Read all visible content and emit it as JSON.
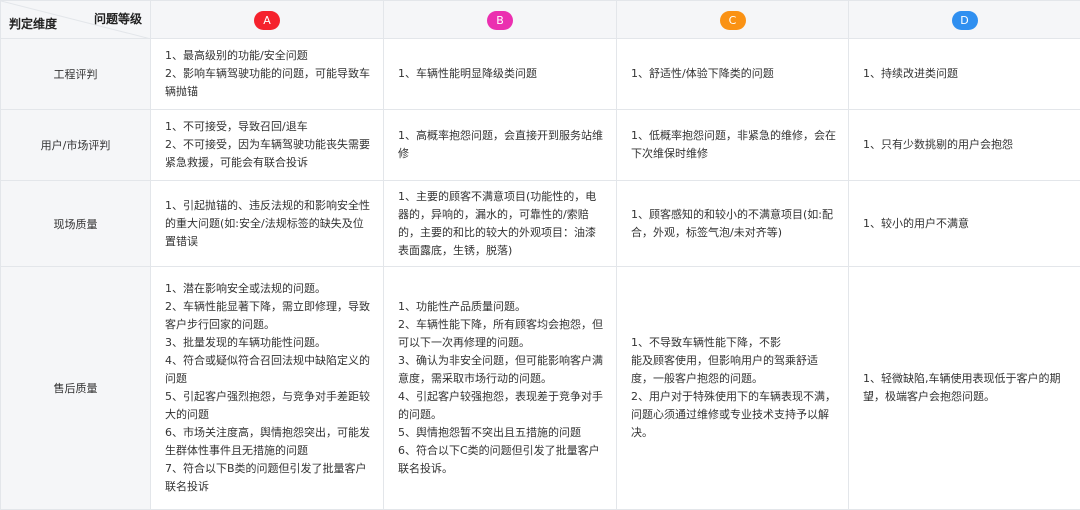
{
  "header": {
    "corner_top": "问题等级",
    "corner_bottom": "判定维度",
    "levels": [
      {
        "label": "A",
        "color": "#f5222d"
      },
      {
        "label": "B",
        "color": "#eb2fb0"
      },
      {
        "label": "C",
        "color": "#fa9214"
      },
      {
        "label": "D",
        "color": "#2f8ff0"
      }
    ]
  },
  "rows": [
    {
      "label": "工程评判",
      "cells": [
        [
          "1、最高级别的功能/安全问题",
          "2、影响车辆驾驶功能的问题，可能导致车辆抛锚"
        ],
        [
          "1、车辆性能明显降级类问题"
        ],
        [
          "1、舒适性/体验下降类的问题"
        ],
        [
          "1、持续改进类问题"
        ]
      ]
    },
    {
      "label": "用户/市场评判",
      "cells": [
        [
          "1、不可接受，导致召回/退车",
          "2、不可接受，因为车辆驾驶功能丧失需要紧急救援，可能会有联合投诉"
        ],
        [
          "1、高概率抱怨问题，会直接开到服务站维修"
        ],
        [
          "1、低概率抱怨问题，非紧急的维修，会在下次维保时维修"
        ],
        [
          "1、只有少数挑剔的用户会抱怨"
        ]
      ]
    },
    {
      "label": "现场质量",
      "cells": [
        [
          "1、引起抛锚的、违反法规的和影响安全性的重大问题(如:安全/法规标签的缺失及位置错误"
        ],
        [
          "1、主要的顾客不满意项目(功能性的，电器的，异响的，漏水的，可靠性的/索赔的，主要的和比的较大的外观项目：油漆表面露底，生锈，脱落)"
        ],
        [
          "1、顾客感知的和较小的不满意项目(如:配合，外观，标签气泡/未对齐等)"
        ],
        [
          "1、较小的用户不满意"
        ]
      ]
    },
    {
      "label": "售后质量",
      "cells": [
        [
          "1、潜在影响安全或法规的问题。",
          "2、车辆性能显著下降，需立即修理，导致客户步行回家的问题。",
          "3、批量发现的车辆功能性问题。",
          "4、符合或疑似符合召回法规中缺陷定义的问题",
          "5、引起客户强烈抱怨，与竞争对手差距较大的问题",
          "6、市场关注度高，舆情抱怨突出，可能发生群体性事件且无措施的问题",
          "7、符合以下B类的问题但引发了批量客户联名投诉"
        ],
        [
          "1、功能性产品质量问题。",
          "2、车辆性能下降，所有顾客均会抱怨，但可以下一次再修理的问题。",
          "3、确认为非安全问题，但可能影响客户满意度，需采取市场行动的问题。",
          "4、引起客户较强抱怨，表现差于竞争对手的问题。",
          "5、舆情抱怨暂不突出且五措施的问题",
          "6、符合以下C类的问题但引发了批量客户联名投诉。"
        ],
        [
          "1、不导致车辆性能下降，不影",
          "能及顾客使用，但影响用户的驾乘舒适度，一般客户抱怨的问题。",
          "2、用户对于特殊使用下的车辆表现不满，问题心须通过维修或专业技术支持予以解决。"
        ],
        [
          "1、轻微缺陷,车辆使用表现低于客户的期望，极端客户会抱怨问题。"
        ]
      ]
    }
  ]
}
